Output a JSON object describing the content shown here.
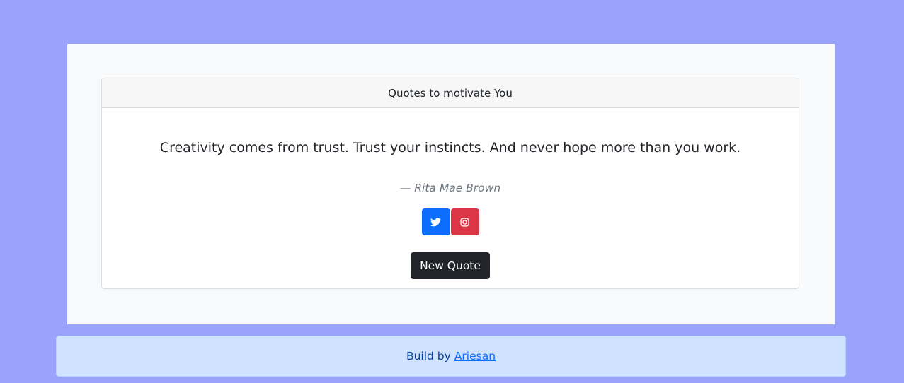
{
  "card": {
    "header": "Quotes to motivate You"
  },
  "quote": {
    "text": "Creativity comes from trust. Trust your instincts. And never hope more than you work.",
    "author": "— Rita Mae Brown"
  },
  "social": {
    "twitter_icon": "twitter-icon",
    "instagram_icon": "instagram-icon"
  },
  "actions": {
    "new_quote_label": "New Quote"
  },
  "footer": {
    "prefix": "Build by",
    "link_label": "Ariesan"
  },
  "colors": {
    "background": "#99a3f9",
    "twitter": "#0d6efd",
    "instagram": "#dc3545",
    "new_quote": "#212529",
    "footer_bg": "#cfe2ff"
  }
}
